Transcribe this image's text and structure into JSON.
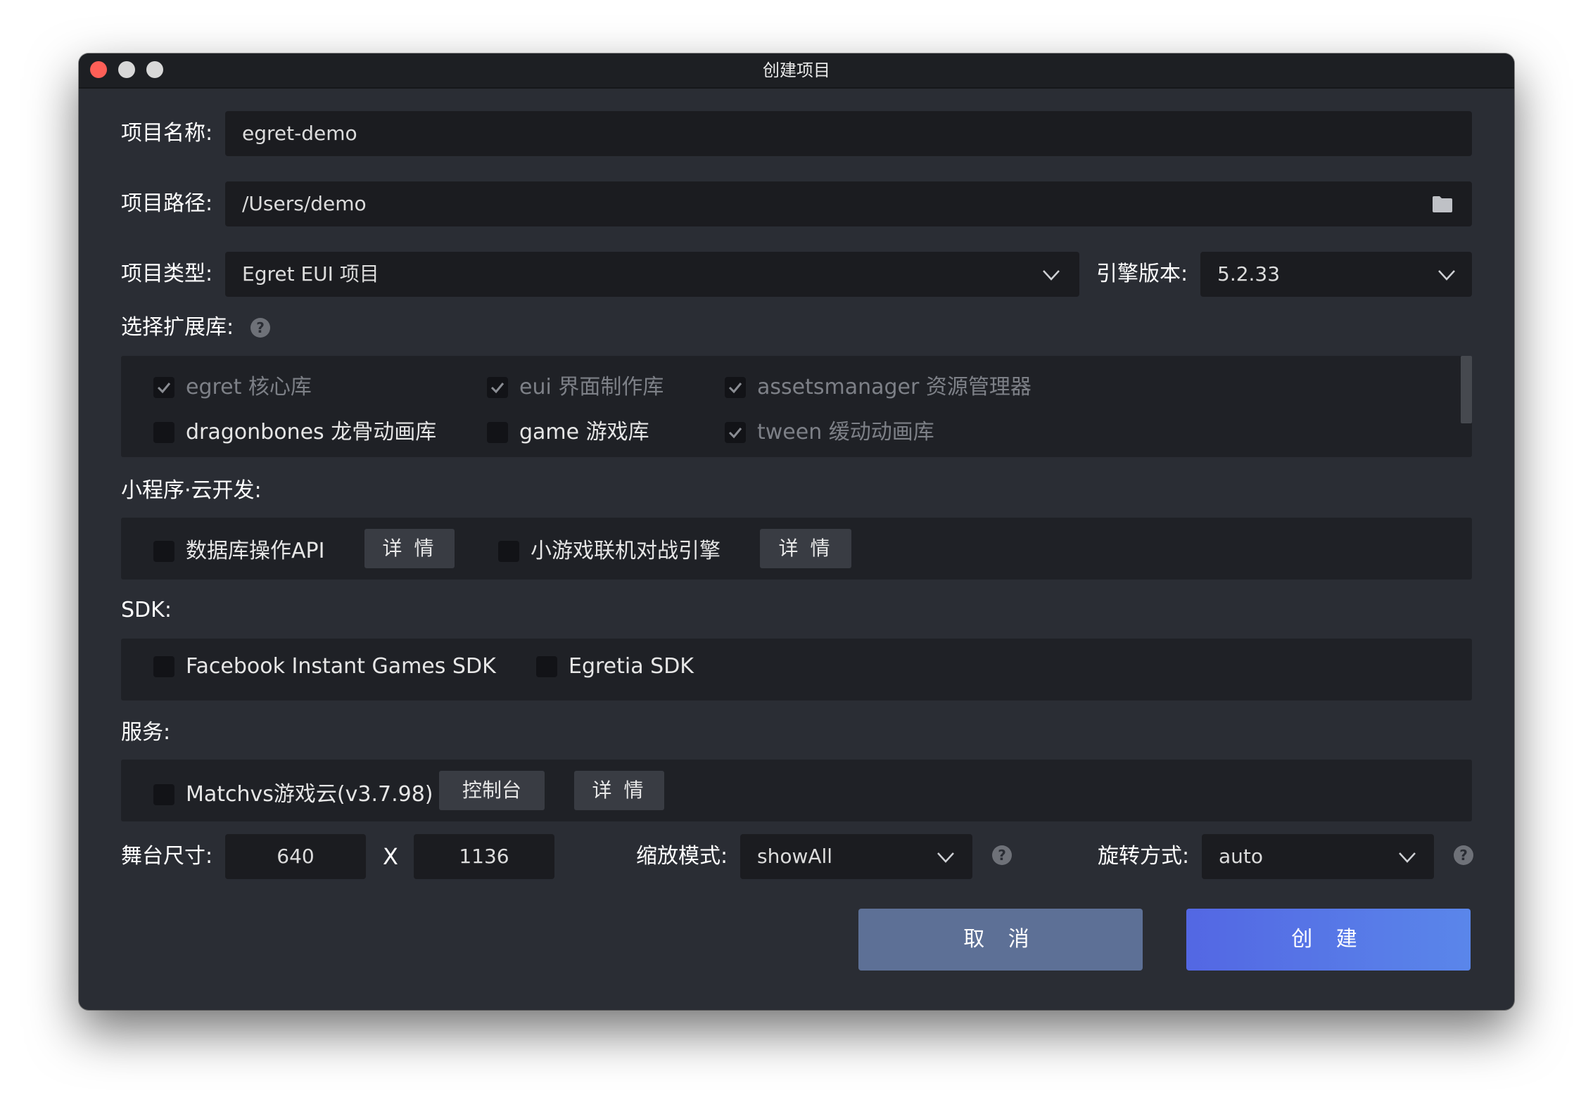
{
  "window": {
    "title": "创建项目"
  },
  "project_name": {
    "label": "项目名称:",
    "value": "egret-demo"
  },
  "project_path": {
    "label": "项目路径:",
    "value": "/Users/demo",
    "icon": "folder-icon"
  },
  "project_type": {
    "label": "项目类型:",
    "value": "Egret EUI 项目"
  },
  "engine_version": {
    "label": "引擎版本:",
    "value": "5.2.33"
  },
  "extensions": {
    "label": "选择扩展库:",
    "items": [
      {
        "label": "egret 核心库",
        "checked": true,
        "disabled": true
      },
      {
        "label": "eui 界面制作库",
        "checked": true,
        "disabled": true
      },
      {
        "label": "assetsmanager 资源管理器",
        "checked": true,
        "disabled": true
      },
      {
        "label": "dragonbones 龙骨动画库",
        "checked": false,
        "disabled": false
      },
      {
        "label": "game 游戏库",
        "checked": false,
        "disabled": false
      },
      {
        "label": "tween 缓动动画库",
        "checked": true,
        "disabled": true
      }
    ]
  },
  "miniprogram": {
    "label": "小程序·云开发:",
    "items": [
      {
        "label": "数据库操作API",
        "detail": "详 情"
      },
      {
        "label": "小游戏联机对战引擎",
        "detail": "详 情"
      }
    ]
  },
  "sdk": {
    "label": "SDK:",
    "items": [
      {
        "label": "Facebook Instant Games SDK"
      },
      {
        "label": "Egretia SDK"
      }
    ]
  },
  "services": {
    "label": "服务:",
    "item": "Matchvs游戏云(v3.7.98)",
    "console": "控制台",
    "detail": "详 情"
  },
  "stage": {
    "label": "舞台尺寸:",
    "width": "640",
    "separator": "X",
    "height": "1136"
  },
  "scale_mode": {
    "label": "缩放模式:",
    "value": "showAll"
  },
  "orientation": {
    "label": "旋转方式:",
    "value": "auto"
  },
  "actions": {
    "cancel": "取 消",
    "create": "创 建"
  },
  "colors": {
    "background": "#2a2d34",
    "field": "#1b1c20",
    "cancel": "#5d7096",
    "create": "#5367e3"
  }
}
